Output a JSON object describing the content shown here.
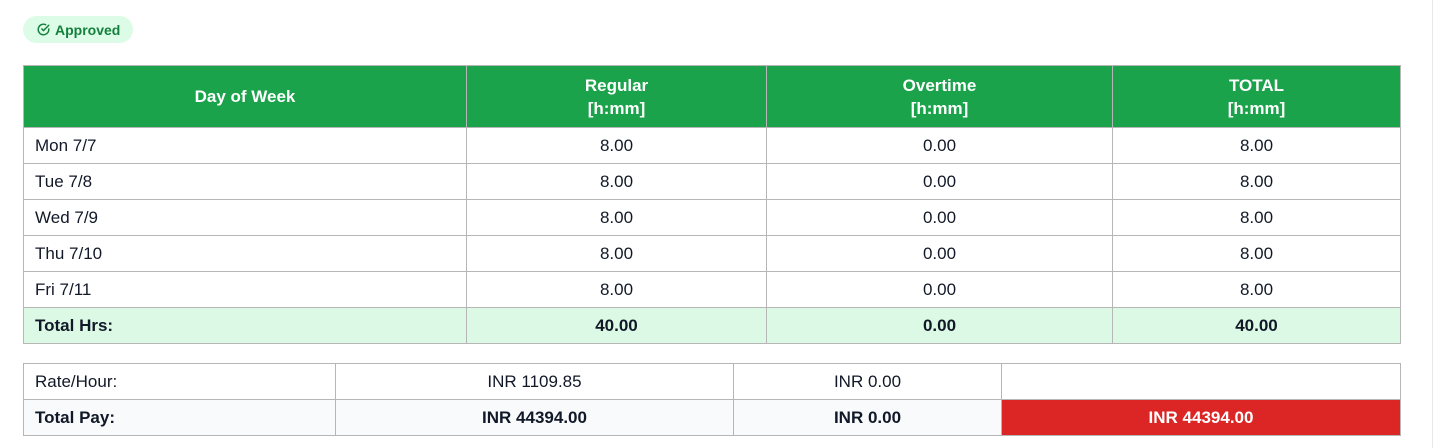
{
  "status_badge": {
    "label": "Approved",
    "icon": "check-circle-icon",
    "color": "#15803d",
    "background": "#dcfce7"
  },
  "hours_table": {
    "header_color": "#1aa34a",
    "columns": [
      {
        "line1": "Day of Week",
        "line2": ""
      },
      {
        "line1": "Regular",
        "line2": "[h:mm]"
      },
      {
        "line1": "Overtime",
        "line2": "[h:mm]"
      },
      {
        "line1": "TOTAL",
        "line2": "[h:mm]"
      }
    ],
    "rows": [
      {
        "day": "Mon 7/7",
        "regular": "8.00",
        "overtime": "0.00",
        "total": "8.00"
      },
      {
        "day": "Tue 7/8",
        "regular": "8.00",
        "overtime": "0.00",
        "total": "8.00"
      },
      {
        "day": "Wed 7/9",
        "regular": "8.00",
        "overtime": "0.00",
        "total": "8.00"
      },
      {
        "day": "Thu 7/10",
        "regular": "8.00",
        "overtime": "0.00",
        "total": "8.00"
      },
      {
        "day": "Fri 7/11",
        "regular": "8.00",
        "overtime": "0.00",
        "total": "8.00"
      }
    ],
    "totals": {
      "label": "Total Hrs:",
      "regular": "40.00",
      "overtime": "0.00",
      "total": "40.00"
    }
  },
  "pay_table": {
    "rate": {
      "label": "Rate/Hour:",
      "regular": "INR 1109.85",
      "overtime": "INR 0.00",
      "total": ""
    },
    "pay": {
      "label": "Total Pay:",
      "regular": "INR 44394.00",
      "overtime": "INR 0.00",
      "total": "INR 44394.00"
    },
    "grand_total_color": "#dc2626"
  }
}
